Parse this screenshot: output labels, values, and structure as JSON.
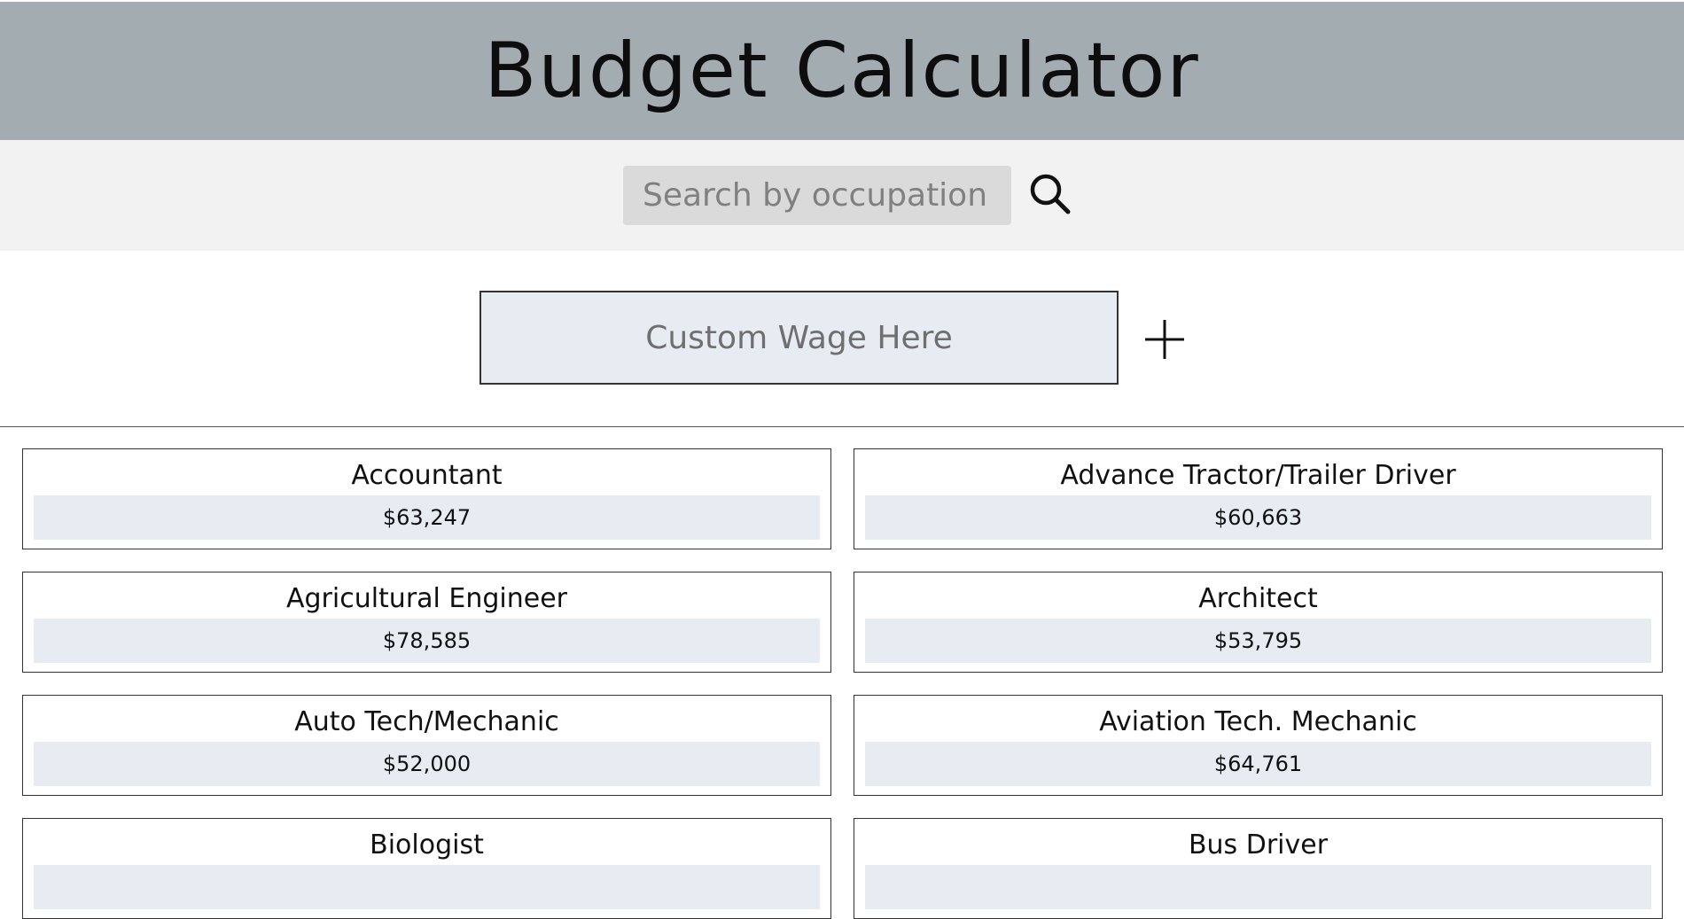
{
  "header": {
    "title": "Budget Calculator"
  },
  "search": {
    "placeholder": "Search by occupation",
    "value": "",
    "icon": "search-icon"
  },
  "custom_wage": {
    "placeholder": "Custom Wage Here",
    "value": "",
    "add_icon": "plus-icon"
  },
  "colors": {
    "header_bg": "#a3acb0",
    "search_bar_bg": "#f2f2f2",
    "search_input_bg": "#dadada",
    "wage_bg": "#e6ecf2"
  },
  "occupations": [
    {
      "title": "Accountant",
      "wage": "$63,247"
    },
    {
      "title": "Advance Tractor/Trailer Driver",
      "wage": "$60,663"
    },
    {
      "title": "Agricultural Engineer",
      "wage": "$78,585"
    },
    {
      "title": "Architect",
      "wage": "$53,795"
    },
    {
      "title": "Auto Tech/Mechanic",
      "wage": "$52,000"
    },
    {
      "title": "Aviation Tech. Mechanic",
      "wage": "$64,761"
    },
    {
      "title": "Biologist",
      "wage": ""
    },
    {
      "title": "Bus Driver",
      "wage": ""
    }
  ]
}
